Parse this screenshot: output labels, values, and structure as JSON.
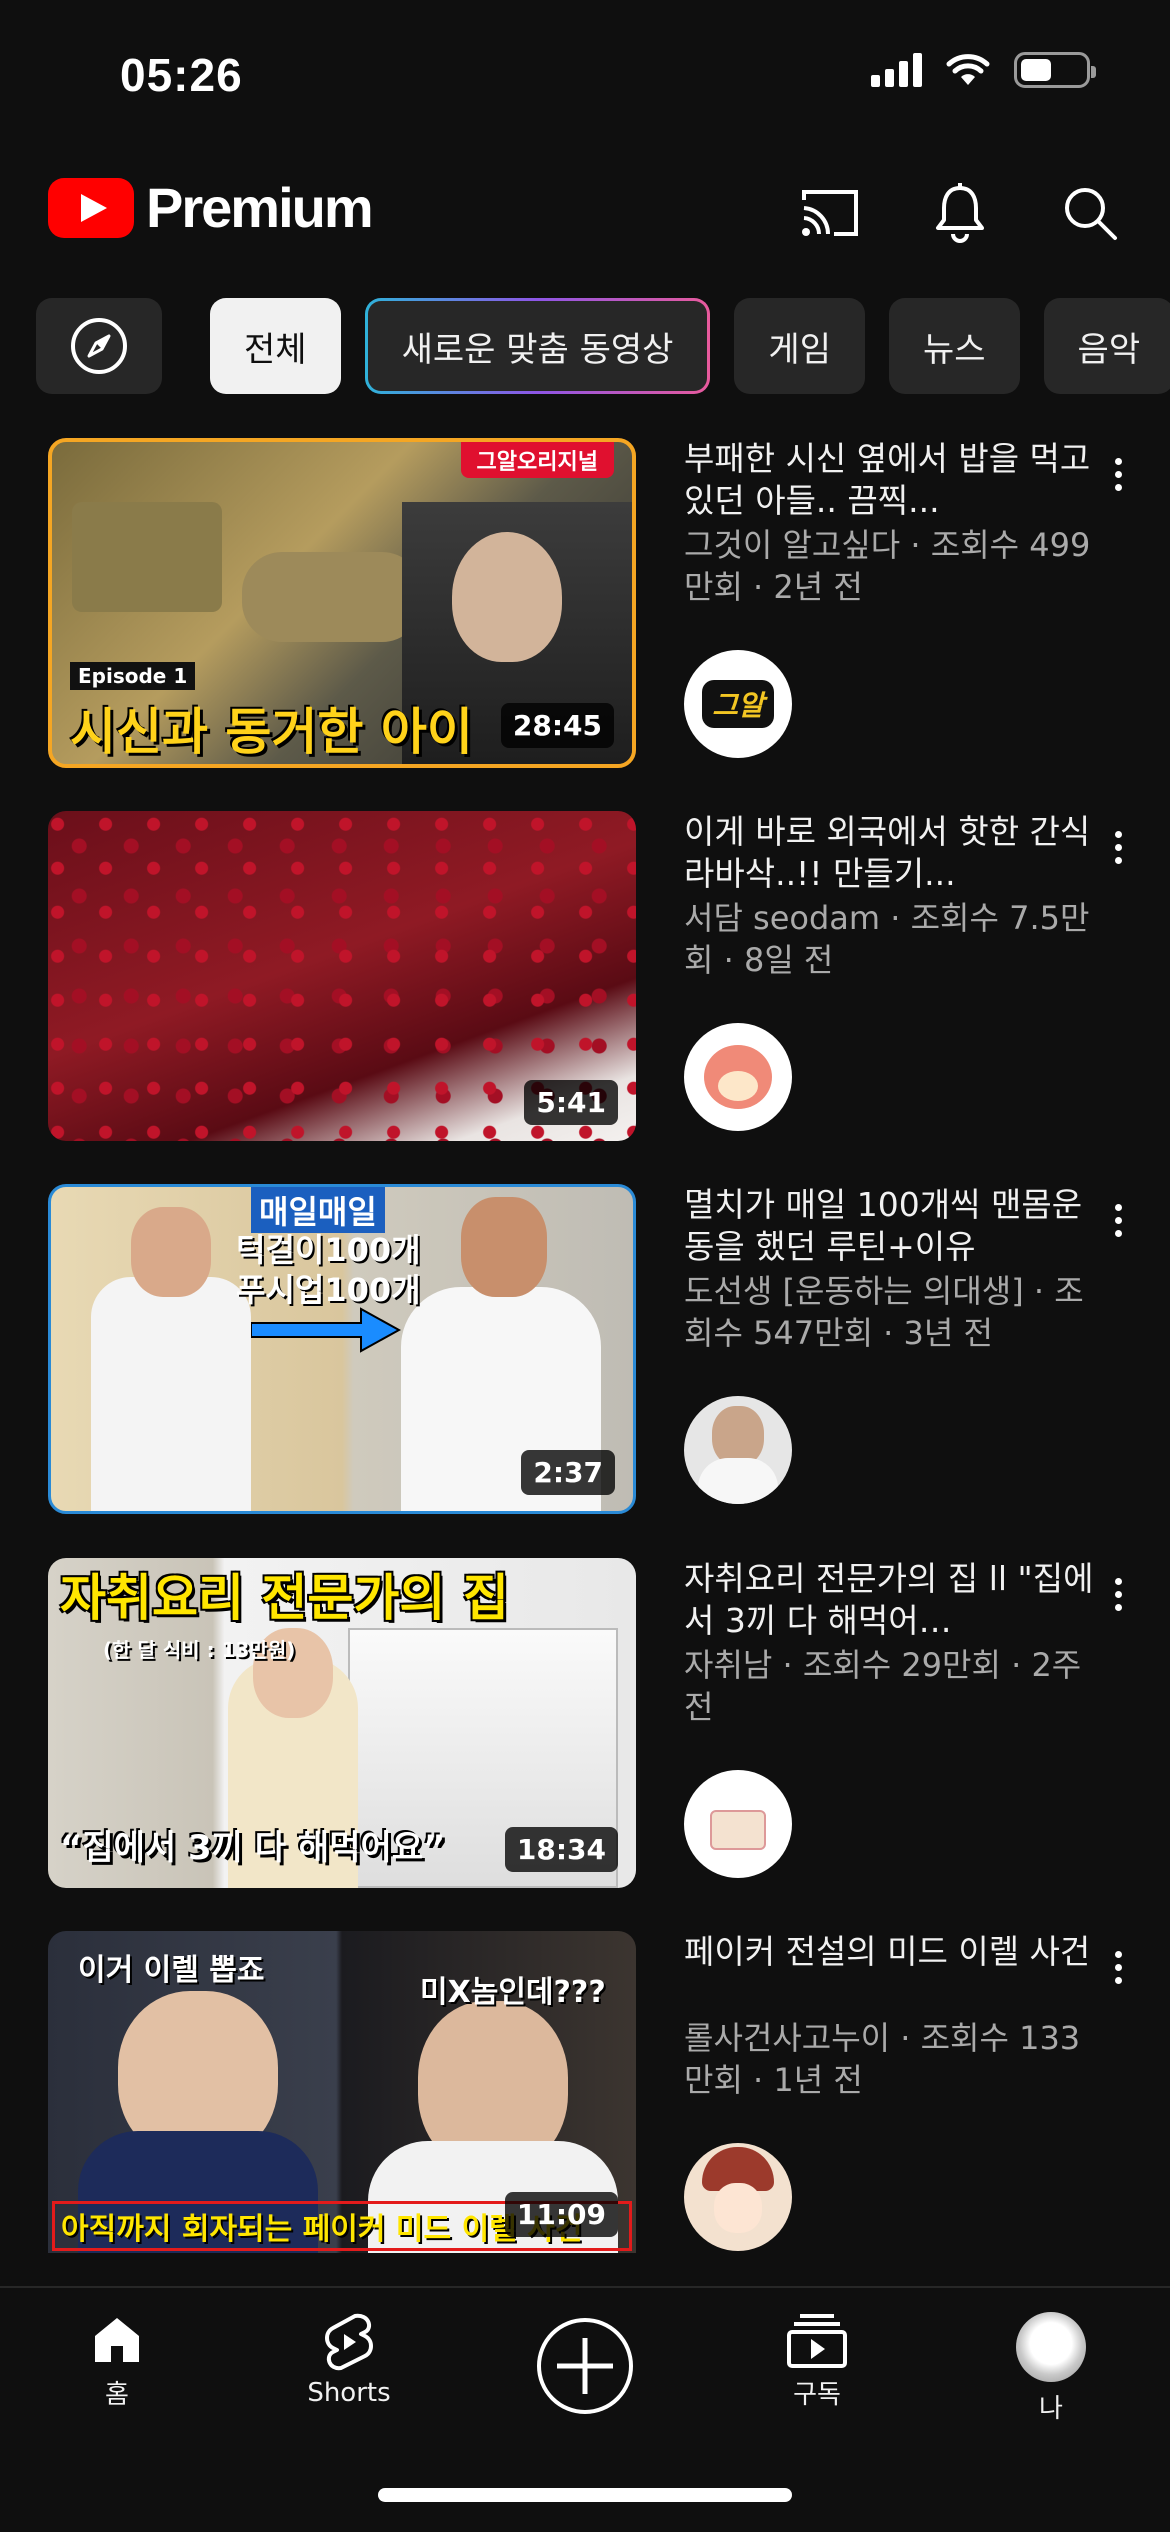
{
  "status": {
    "time": "05:26"
  },
  "header": {
    "logo_text": "Premium"
  },
  "chips": [
    "전체",
    "새로운 맞춤 동영상",
    "게임",
    "뉴스",
    "음악"
  ],
  "videos": [
    {
      "title": "부패한 시신 옆에서 밥을 먹고 있던 아들.. 끔찍...",
      "meta": "그것이 알고싶다 · 조회수 499만회 · 2년 전",
      "duration": "28:45",
      "thumb_tag": "그알오리지널",
      "thumb_caption": "시신과 동거한 아이",
      "thumb_episode": "Episode 1",
      "avatar_label": "그알"
    },
    {
      "title": "이게 바로 외국에서 핫한 간식 라바삭..!! 만들기...",
      "meta": "서담 seodam · 조회수 7.5만회 · 8일 전",
      "duration": "5:41"
    },
    {
      "title": "멸치가 매일 100개씩 맨몸운동을 했던 루틴+이유",
      "meta": "도선생 [운동하는 의대생] · 조회수 547만회 · 3년 전",
      "duration": "2:37",
      "thumb_line1": "매일매일",
      "thumb_line2": "턱걸이100개",
      "thumb_line3": "푸시업100개"
    },
    {
      "title": "자취요리 전문가의 집 ll \"집에서 3끼 다 해먹어…",
      "meta": "자취남 · 조회수 29만회 · 2주 전",
      "duration": "18:34",
      "thumb_title": "자취요리 전문가의 집",
      "thumb_sub": "(한 달 식비 : 13만원)",
      "thumb_quote": "“집에서 3끼 다 해먹어요”"
    },
    {
      "title": "페이커 전설의 미드 이렐 사건",
      "meta": "롤사건사고누이 · 조회수 133만회 · 1년 전",
      "duration": "11:09",
      "thumb_top_left": "이거 이렐 뽑죠",
      "thumb_top_right": "미X놈인데???",
      "thumb_bottom": "아직까지 회자되는 페이커 미드 이렐 사건"
    }
  ],
  "nav": {
    "home": "홈",
    "shorts": "Shorts",
    "subscriptions": "구독",
    "you": "나"
  },
  "colors": {
    "background": "#0f0f0f",
    "chip": "#272727",
    "brand": "#ff0000"
  }
}
